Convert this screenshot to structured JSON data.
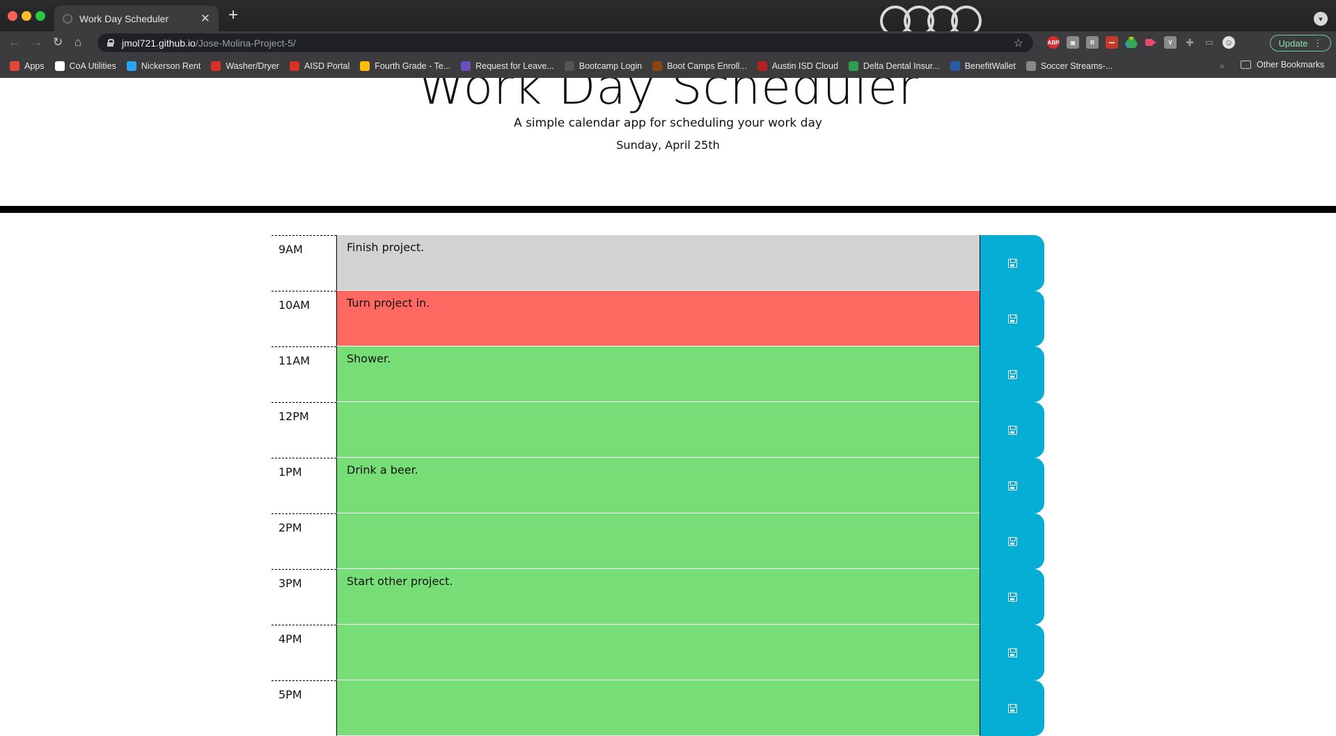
{
  "browser": {
    "tab_title": "Work Day Scheduler",
    "tab_close": "✕",
    "new_tab": "+",
    "url_host": "jmol721.github.io",
    "url_path": "/Jose-Molina-Project-5/",
    "update_label": "Update",
    "bookmarks": [
      {
        "label": "Apps",
        "icon_color": "#e8453c"
      },
      {
        "label": "CoA Utilities",
        "icon_color": "#ffffff"
      },
      {
        "label": "Nickerson Rent",
        "icon_color": "#2ea3f2"
      },
      {
        "label": "Washer/Dryer",
        "icon_color": "#d93025"
      },
      {
        "label": "AISD Portal",
        "icon_color": "#d93025"
      },
      {
        "label": "Fourth Grade - Te...",
        "icon_color": "#fbbc04"
      },
      {
        "label": "Request for Leave...",
        "icon_color": "#6b4fbb"
      },
      {
        "label": "Bootcamp Login",
        "icon_color": "#555555"
      },
      {
        "label": "Boot Camps Enroll...",
        "icon_color": "#8b4513"
      },
      {
        "label": "Austin ISD Cloud",
        "icon_color": "#b22222"
      },
      {
        "label": "Delta Dental Insur...",
        "icon_color": "#2e9e4f"
      },
      {
        "label": "BenefitWallet",
        "icon_color": "#2b5aa6"
      },
      {
        "label": "Soccer Streams-...",
        "icon_color": "#888888"
      }
    ],
    "bookmarks_overflow": "»",
    "other_bookmarks": "Other Bookmarks"
  },
  "header": {
    "title": "Work Day Scheduler",
    "lead": "A simple calendar app for scheduling your work day",
    "current_day": "Sunday, April 25th"
  },
  "time_blocks": [
    {
      "hour": "9AM",
      "text": "Finish project.",
      "status": "past"
    },
    {
      "hour": "10AM",
      "text": "Turn project in.",
      "status": "present"
    },
    {
      "hour": "11AM",
      "text": "Shower.",
      "status": "future"
    },
    {
      "hour": "12PM",
      "text": "",
      "status": "future"
    },
    {
      "hour": "1PM",
      "text": "Drink a beer.",
      "status": "future"
    },
    {
      "hour": "2PM",
      "text": "",
      "status": "future"
    },
    {
      "hour": "3PM",
      "text": "Start other project.",
      "status": "future"
    },
    {
      "hour": "4PM",
      "text": "",
      "status": "future"
    },
    {
      "hour": "5PM",
      "text": "",
      "status": "future"
    }
  ],
  "colors": {
    "past": "#d3d3d3",
    "present": "#ff6961",
    "future": "#77dd77",
    "save_button": "#06aed5"
  },
  "icons": {
    "save": "save-icon"
  }
}
